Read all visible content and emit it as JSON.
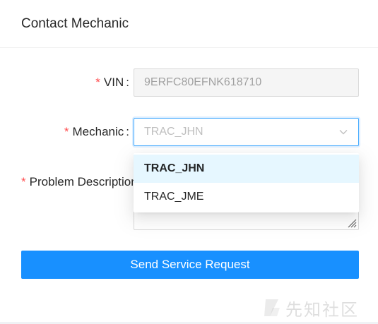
{
  "modal": {
    "title": "Contact Mechanic"
  },
  "form": {
    "vin": {
      "label": "VIN",
      "required_mark": "*",
      "colon": ":",
      "value": "9ERFC80EFNK618710"
    },
    "mechanic": {
      "label": "Mechanic",
      "required_mark": "*",
      "colon": ":",
      "placeholder_value": "TRAC_JHN",
      "options": [
        "TRAC_JHN",
        "TRAC_JME"
      ],
      "active_option": "TRAC_JHN"
    },
    "problem": {
      "label": "Problem Description",
      "required_mark": "*"
    },
    "submit_label": "Send Service Request"
  },
  "watermark": {
    "text": "先知社区"
  },
  "colors": {
    "primary": "#1890ff",
    "required": "#ff4d4f",
    "option_active_bg": "#e6f7ff"
  }
}
